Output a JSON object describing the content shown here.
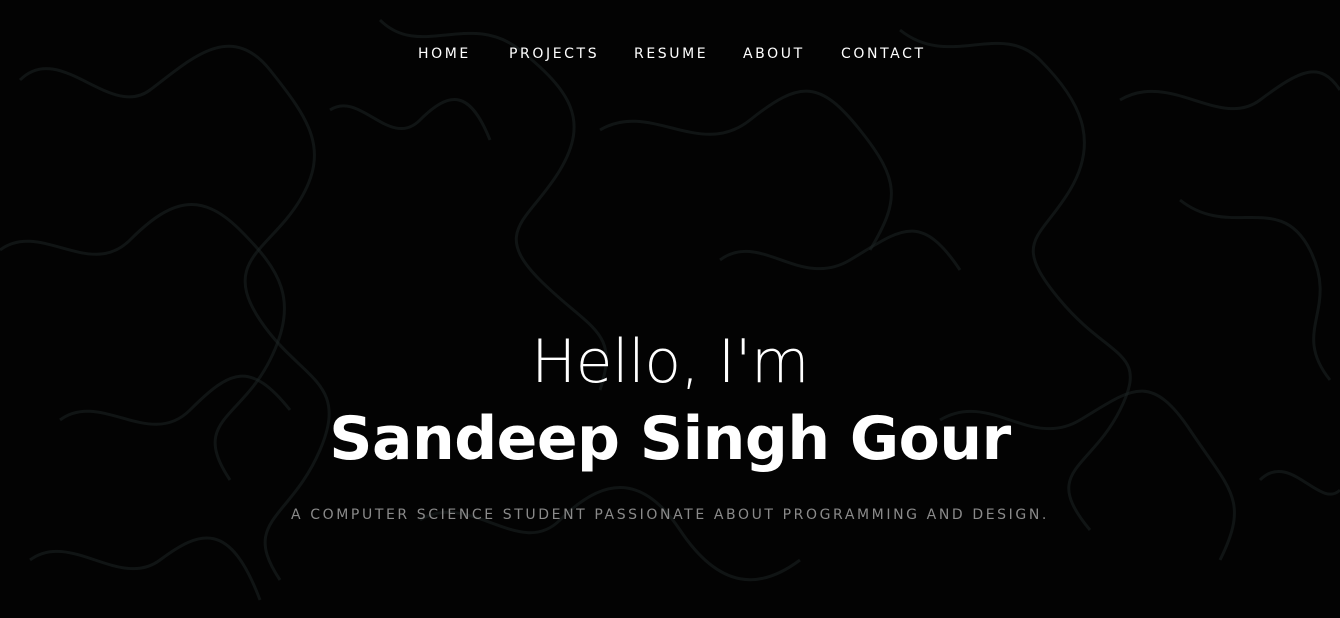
{
  "nav": {
    "items": [
      {
        "label": "HOME"
      },
      {
        "label": "PROJECTS"
      },
      {
        "label": "RESUME"
      },
      {
        "label": "ABOUT"
      },
      {
        "label": "CONTACT"
      }
    ]
  },
  "hero": {
    "greeting": "Hello, I'm",
    "name": "Sandeep Singh Gour",
    "tagline": "A COMPUTER SCIENCE STUDENT PASSIONATE ABOUT PROGRAMMING AND DESIGN."
  },
  "colors": {
    "background": "#030303",
    "text": "#ffffff",
    "tagline": "#8a8a8a",
    "texture": "#1b2222"
  }
}
